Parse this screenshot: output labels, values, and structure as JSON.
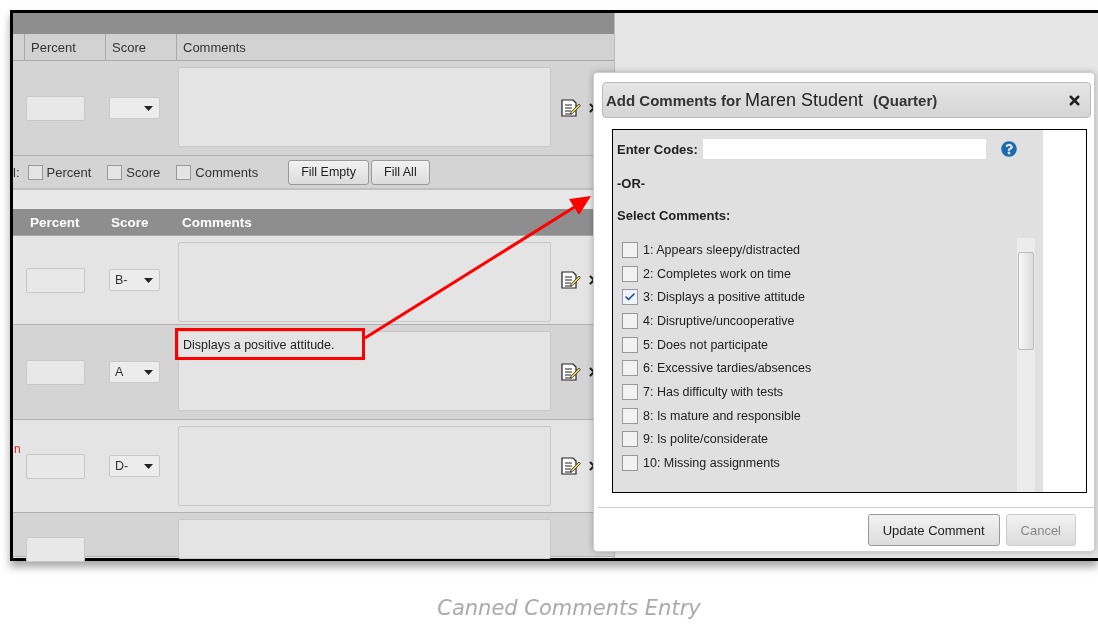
{
  "grade_table": {
    "columns": [
      "Percent",
      "Score",
      "Comments"
    ],
    "fill_row": {
      "label": "l:",
      "checks": [
        {
          "label": "Percent",
          "checked": false
        },
        {
          "label": "Score",
          "checked": false
        },
        {
          "label": "Comments",
          "checked": false
        }
      ],
      "buttons": [
        "Fill Empty",
        "Fill All"
      ]
    }
  },
  "student_table": {
    "columns": [
      "Percent",
      "Score",
      "Comments"
    ],
    "rows": [
      {
        "score": "B-"
      },
      {
        "score": "A",
        "comment": "Displays a positive attitude.",
        "highlighted": true
      },
      {
        "score": "D-",
        "flag": "n"
      },
      {}
    ]
  },
  "dialog": {
    "title": "Add Comments for",
    "student": "Maren Student",
    "term": "(Quarter)",
    "codes_label": "Enter Codes:",
    "or_label": "-OR-",
    "select_label": "Select Comments:",
    "comments": [
      {
        "label": "1: Appears sleepy/distracted",
        "checked": false
      },
      {
        "label": "2: Completes work on time",
        "checked": false
      },
      {
        "label": "3: Displays a positive attitude",
        "checked": true
      },
      {
        "label": "4: Disruptive/uncooperative",
        "checked": false
      },
      {
        "label": "5: Does not participate",
        "checked": false
      },
      {
        "label": "6: Excessive tardies/absences",
        "checked": false
      },
      {
        "label": "7: Has difficulty with tests",
        "checked": false
      },
      {
        "label": "8: Is mature and responsible",
        "checked": false
      },
      {
        "label": "9: Is polite/considerate",
        "checked": false
      },
      {
        "label": "10: Missing assignments",
        "checked": false
      }
    ],
    "buttons": [
      {
        "label": "Update Comment",
        "disabled": false
      },
      {
        "label": "Cancel",
        "disabled": true
      }
    ]
  },
  "caption": "Canned Comments Entry"
}
